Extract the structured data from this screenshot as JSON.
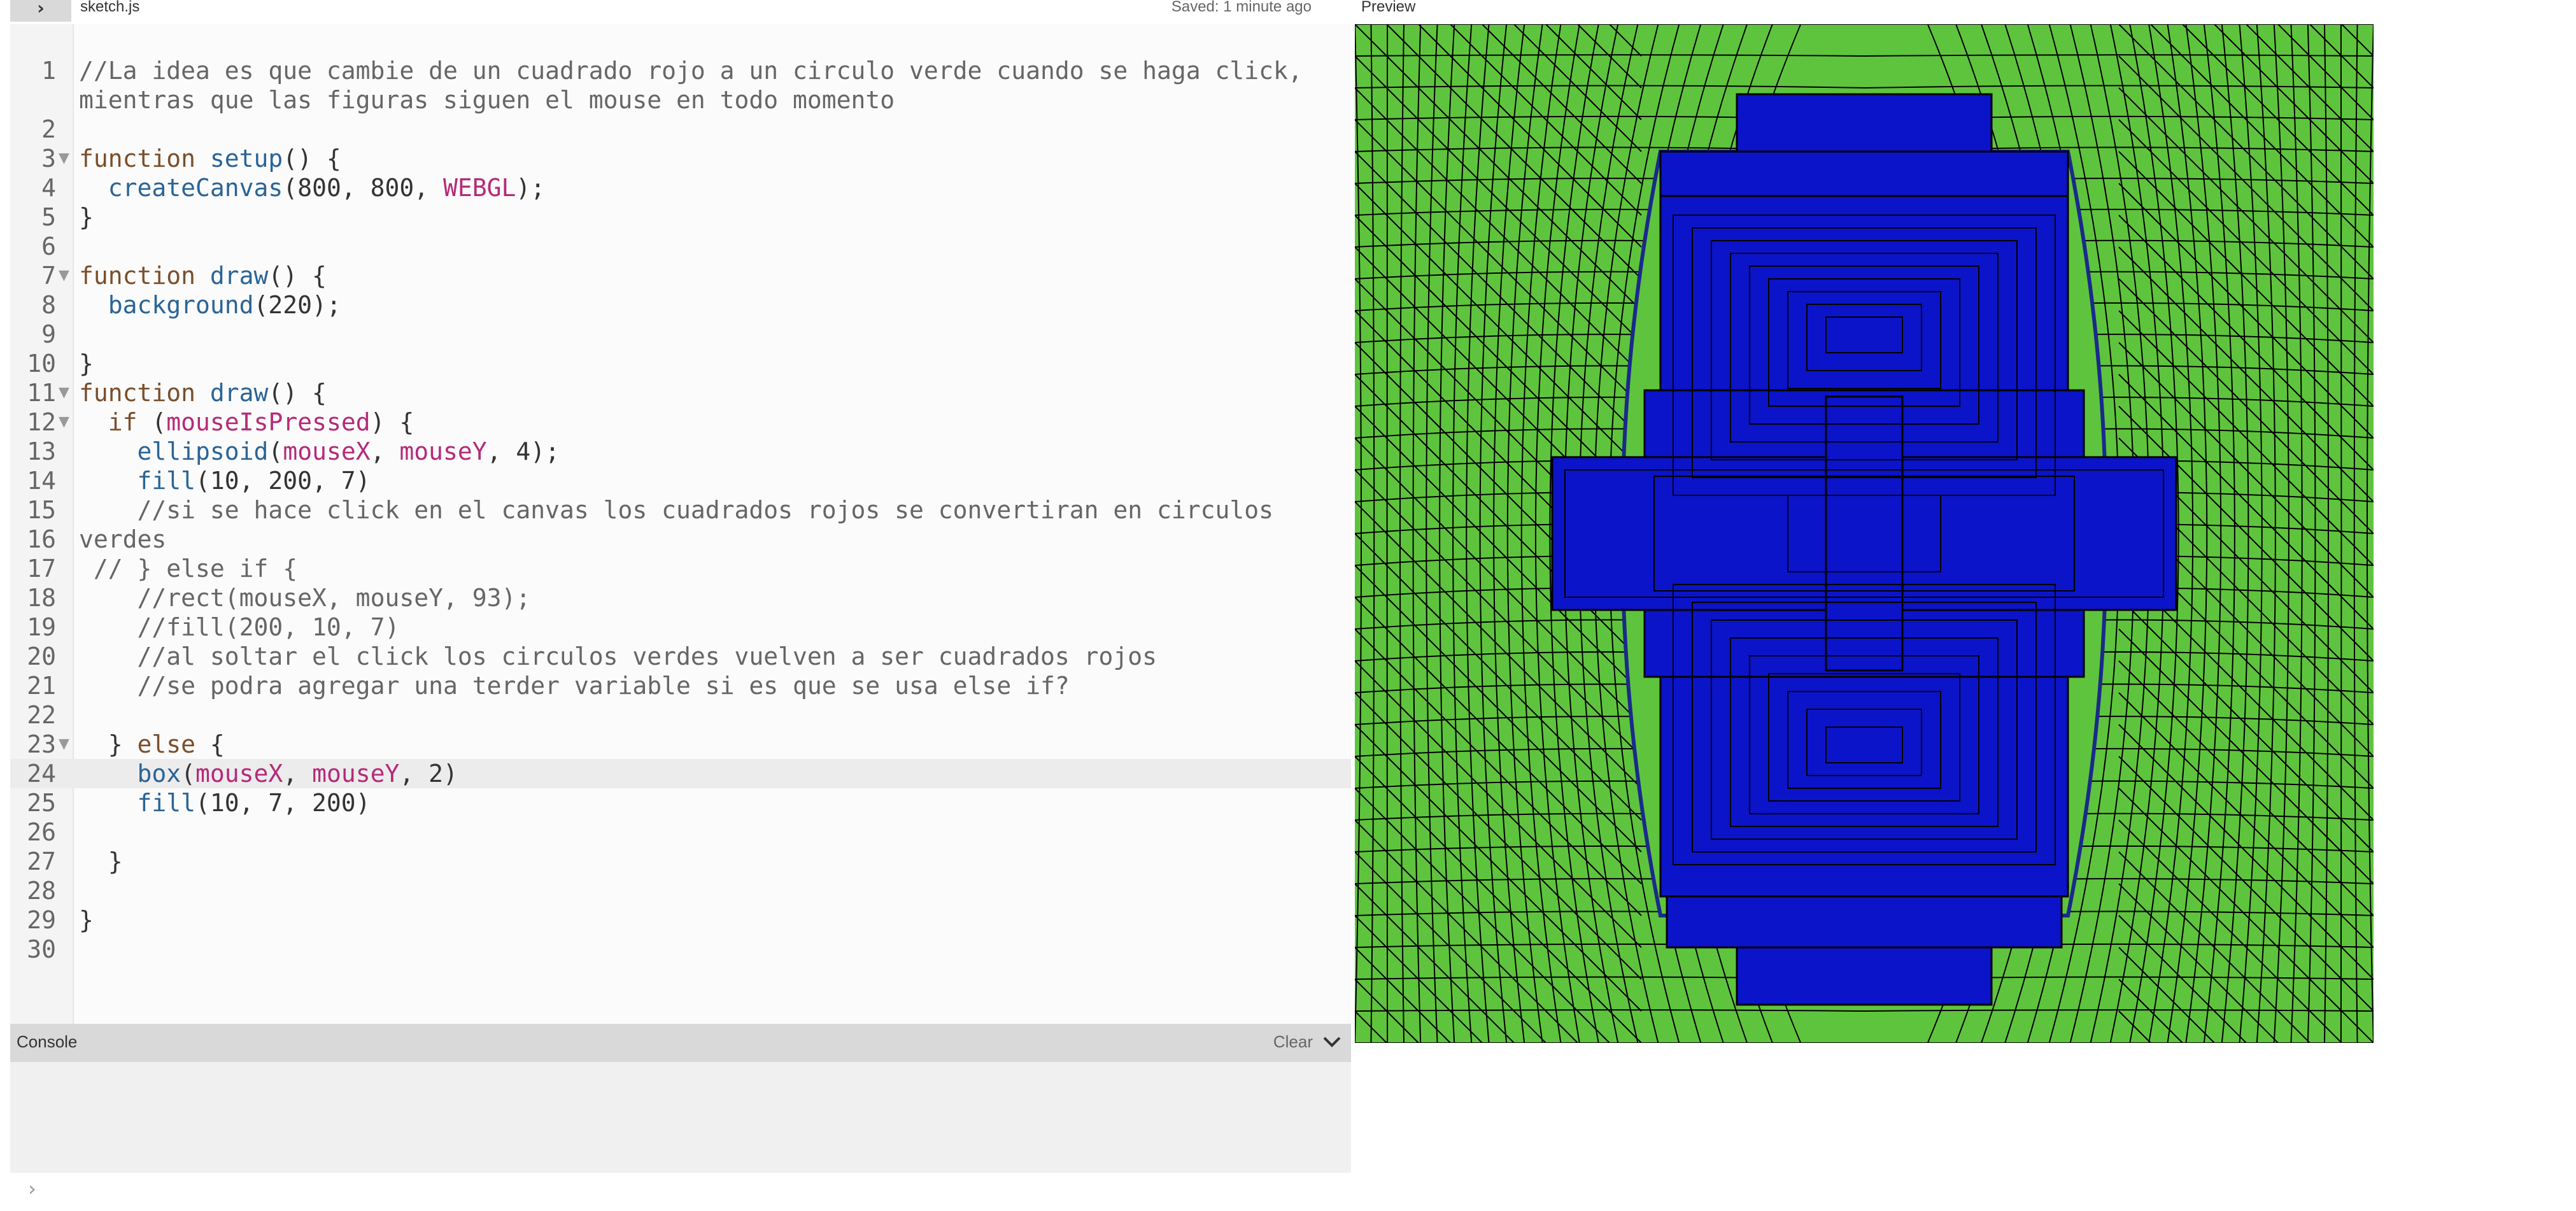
{
  "header": {
    "toggle_icon": "chevron-right-icon",
    "file_name": "sketch.js",
    "save_status": "Saved: 1 minute ago",
    "preview_label": "Preview"
  },
  "editor": {
    "lines": [
      {
        "n": "1",
        "fold": false,
        "tokens": [
          {
            "t": "comment",
            "v": "//La idea es que cambie de un cuadrado rojo a un circulo verde cuando se haga click, mientras que las figuras siguen el mouse en todo momento"
          }
        ]
      },
      {
        "n": "2",
        "fold": false,
        "tokens": []
      },
      {
        "n": "3",
        "fold": true,
        "tokens": [
          {
            "t": "keyword",
            "v": "function "
          },
          {
            "t": "func",
            "v": "setup"
          },
          {
            "t": "plain",
            "v": "() {"
          }
        ]
      },
      {
        "n": "4",
        "fold": false,
        "tokens": [
          {
            "t": "plain",
            "v": "  "
          },
          {
            "t": "func",
            "v": "createCanvas"
          },
          {
            "t": "plain",
            "v": "(800, 800, "
          },
          {
            "t": "var",
            "v": "WEBGL"
          },
          {
            "t": "plain",
            "v": ");"
          }
        ]
      },
      {
        "n": "5",
        "fold": false,
        "tokens": [
          {
            "t": "plain",
            "v": "}"
          }
        ]
      },
      {
        "n": "6",
        "fold": false,
        "tokens": []
      },
      {
        "n": "7",
        "fold": true,
        "tokens": [
          {
            "t": "keyword",
            "v": "function "
          },
          {
            "t": "func",
            "v": "draw"
          },
          {
            "t": "plain",
            "v": "() {"
          }
        ]
      },
      {
        "n": "8",
        "fold": false,
        "tokens": [
          {
            "t": "plain",
            "v": "  "
          },
          {
            "t": "func",
            "v": "background"
          },
          {
            "t": "plain",
            "v": "(220);"
          }
        ]
      },
      {
        "n": "9",
        "fold": false,
        "tokens": []
      },
      {
        "n": "10",
        "fold": false,
        "tokens": [
          {
            "t": "plain",
            "v": "}"
          }
        ]
      },
      {
        "n": "11",
        "fold": true,
        "tokens": [
          {
            "t": "keyword",
            "v": "function "
          },
          {
            "t": "func",
            "v": "draw"
          },
          {
            "t": "plain",
            "v": "() {"
          }
        ]
      },
      {
        "n": "12",
        "fold": true,
        "tokens": [
          {
            "t": "plain",
            "v": "  "
          },
          {
            "t": "keyword",
            "v": "if "
          },
          {
            "t": "plain",
            "v": "("
          },
          {
            "t": "var",
            "v": "mouseIsPressed"
          },
          {
            "t": "plain",
            "v": ") {"
          }
        ]
      },
      {
        "n": "13",
        "fold": false,
        "tokens": [
          {
            "t": "plain",
            "v": "    "
          },
          {
            "t": "func",
            "v": "ellipsoid"
          },
          {
            "t": "plain",
            "v": "("
          },
          {
            "t": "var",
            "v": "mouseX"
          },
          {
            "t": "plain",
            "v": ", "
          },
          {
            "t": "var",
            "v": "mouseY"
          },
          {
            "t": "plain",
            "v": ", 4);"
          }
        ]
      },
      {
        "n": "14",
        "fold": false,
        "tokens": [
          {
            "t": "plain",
            "v": "    "
          },
          {
            "t": "func",
            "v": "fill"
          },
          {
            "t": "plain",
            "v": "(10, 200, 7)"
          }
        ]
      },
      {
        "n": "15",
        "fold": false,
        "tokens": [
          {
            "t": "comment",
            "v": "    //si se hace click en el canvas los cuadrados rojos se convertiran en circulos verdes"
          }
        ]
      },
      {
        "n": "16",
        "fold": false,
        "tokens": []
      },
      {
        "n": "17",
        "fold": false,
        "tokens": [
          {
            "t": "comment",
            "v": " // } else if {"
          }
        ]
      },
      {
        "n": "18",
        "fold": false,
        "tokens": [
          {
            "t": "comment",
            "v": "    //rect(mouseX, mouseY, 93);"
          }
        ]
      },
      {
        "n": "19",
        "fold": false,
        "tokens": [
          {
            "t": "comment",
            "v": "    //fill(200, 10, 7)"
          }
        ]
      },
      {
        "n": "20",
        "fold": false,
        "tokens": [
          {
            "t": "comment",
            "v": "    //al soltar el click los circulos verdes vuelven a ser cuadrados rojos"
          }
        ]
      },
      {
        "n": "21",
        "fold": false,
        "tokens": [
          {
            "t": "comment",
            "v": "    //se podra agregar una terder variable si es que se usa else if?"
          }
        ]
      },
      {
        "n": "22",
        "fold": false,
        "tokens": []
      },
      {
        "n": "23",
        "fold": true,
        "tokens": [
          {
            "t": "plain",
            "v": "  } "
          },
          {
            "t": "keyword",
            "v": "else"
          },
          {
            "t": "plain",
            "v": " {"
          }
        ]
      },
      {
        "n": "24",
        "fold": false,
        "active": true,
        "tokens": [
          {
            "t": "plain",
            "v": "    "
          },
          {
            "t": "func",
            "v": "box"
          },
          {
            "t": "plain",
            "v": "("
          },
          {
            "t": "var",
            "v": "mouseX"
          },
          {
            "t": "plain",
            "v": ", "
          },
          {
            "t": "var",
            "v": "mouseY"
          },
          {
            "t": "plain",
            "v": ", 2)"
          }
        ]
      },
      {
        "n": "25",
        "fold": false,
        "tokens": [
          {
            "t": "plain",
            "v": "    "
          },
          {
            "t": "func",
            "v": "fill"
          },
          {
            "t": "plain",
            "v": "(10, 7, 200)"
          }
        ]
      },
      {
        "n": "26",
        "fold": false,
        "tokens": []
      },
      {
        "n": "27",
        "fold": false,
        "tokens": [
          {
            "t": "plain",
            "v": "  }"
          }
        ]
      },
      {
        "n": "28",
        "fold": false,
        "tokens": []
      },
      {
        "n": "29",
        "fold": false,
        "tokens": [
          {
            "t": "plain",
            "v": "}"
          }
        ]
      },
      {
        "n": "30",
        "fold": false,
        "tokens": []
      }
    ],
    "fold_icon": "fold-triangle-icon"
  },
  "console": {
    "title": "Console",
    "clear_label": "Clear",
    "collapse_icon": "chevron-down-icon",
    "prompt_symbol": "›"
  },
  "preview": {
    "background_color": "#5fc43d",
    "box_color": "#0b14c8",
    "edge_color": "#000000"
  }
}
